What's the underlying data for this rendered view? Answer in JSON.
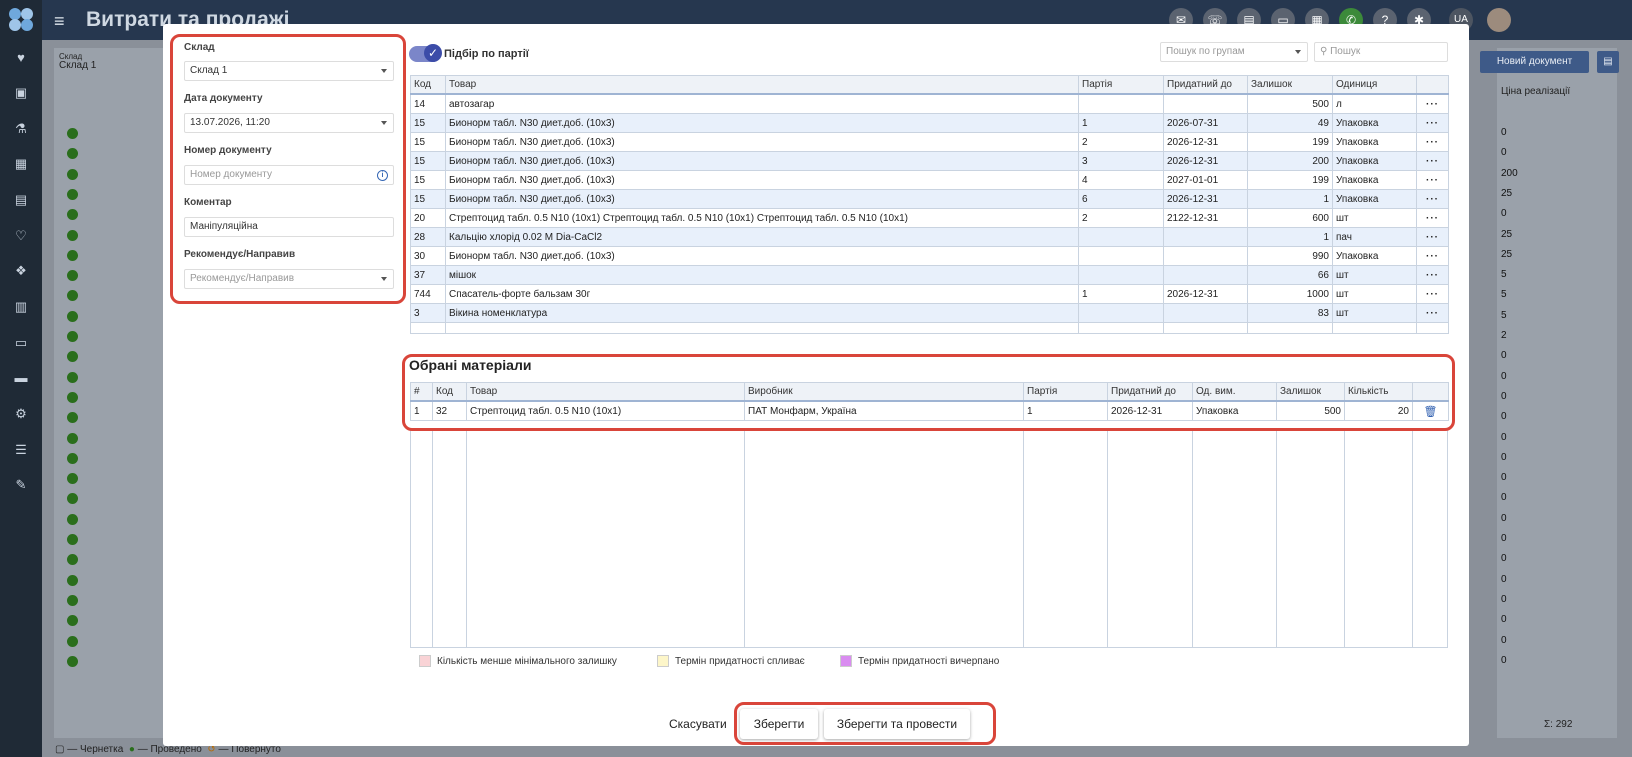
{
  "app": {
    "title": "Витрати та продажі",
    "lang": "UA",
    "notification_badge": "1",
    "new_document_label": "Новий документ",
    "bg_left_header": "Склад",
    "bg_left_value": "Склад 1",
    "bg_right_header": "Ціна реалізації",
    "bg_right_values": [
      "0",
      "0",
      "200",
      "25",
      "0",
      "25",
      "25",
      "5",
      "5",
      "5",
      "2",
      "0",
      "0",
      "0",
      "0",
      "0",
      "0",
      "0",
      "0",
      "0",
      "0",
      "0",
      "0",
      "0",
      "0",
      "0",
      "0"
    ],
    "bg_sum": "Σ: 292",
    "footer_legend": [
      "— Чернетка",
      "— Проведено",
      "— Повернуто"
    ]
  },
  "form": {
    "warehouse_label": "Склад",
    "warehouse_value": "Склад 1",
    "date_label": "Дата документу",
    "date_value": "13.07.2026, 11:20",
    "number_label": "Номер документу",
    "number_placeholder": "Номер документу",
    "comment_label": "Коментар",
    "comment_value": "Маніпуляційна",
    "recommender_label": "Рекомендує/Направив",
    "recommender_placeholder": "Рекомендує/Направив"
  },
  "toolbar": {
    "batch_toggle_label": "Підбір по партії",
    "batch_toggle_on": true,
    "group_search_placeholder": "Пошук по групам",
    "search_placeholder": "Пошук"
  },
  "products": {
    "columns": [
      "Код",
      "Товар",
      "Партія",
      "Придатний до",
      "Залишок",
      "Одиниця"
    ],
    "rows": [
      {
        "code": "14",
        "name": "автозагар",
        "batch": "",
        "expiry": "",
        "stock": "500",
        "unit": "л"
      },
      {
        "code": "15",
        "name": "Бионорм табл. N30 диет.доб. (10х3)",
        "batch": "1",
        "expiry": "2026-07-31",
        "stock": "49",
        "unit": "Упаковка"
      },
      {
        "code": "15",
        "name": "Бионорм табл. N30 диет.доб. (10х3)",
        "batch": "2",
        "expiry": "2026-12-31",
        "stock": "199",
        "unit": "Упаковка"
      },
      {
        "code": "15",
        "name": "Бионорм табл. N30 диет.доб. (10х3)",
        "batch": "3",
        "expiry": "2026-12-31",
        "stock": "200",
        "unit": "Упаковка"
      },
      {
        "code": "15",
        "name": "Бионорм табл. N30 диет.доб. (10х3)",
        "batch": "4",
        "expiry": "2027-01-01",
        "stock": "199",
        "unit": "Упаковка"
      },
      {
        "code": "15",
        "name": "Бионорм табл. N30 диет.доб. (10х3)",
        "batch": "6",
        "expiry": "2026-12-31",
        "stock": "1",
        "unit": "Упаковка"
      },
      {
        "code": "20",
        "name": "Стрептоцид табл. 0.5 N10 (10х1) Стрептоцид табл. 0.5 N10 (10х1) Стрептоцид табл. 0.5 N10 (10х1)",
        "batch": "2",
        "expiry": "2122-12-31",
        "stock": "600",
        "unit": "шт"
      },
      {
        "code": "28",
        "name": "Кальцію хлорід 0.02 М Dia-CaCl2",
        "batch": "",
        "expiry": "",
        "stock": "1",
        "unit": "пач"
      },
      {
        "code": "30",
        "name": "Бионорм табл. N30 диет.доб. (10х3)",
        "batch": "",
        "expiry": "",
        "stock": "990",
        "unit": "Упаковка"
      },
      {
        "code": "37",
        "name": "мішок",
        "batch": "",
        "expiry": "",
        "stock": "66",
        "unit": "шт"
      },
      {
        "code": "744",
        "name": "Спасатель-форте бальзам 30г",
        "batch": "1",
        "expiry": "2026-12-31",
        "stock": "1000",
        "unit": "шт"
      },
      {
        "code": "3",
        "name": "Вікина номенклатура",
        "batch": "",
        "expiry": "",
        "stock": "83",
        "unit": "шт"
      }
    ]
  },
  "selected": {
    "title": "Обрані матеріали",
    "columns": [
      "#",
      "Код",
      "Товар",
      "Виробник",
      "Партія",
      "Придатний до",
      "Од. вим.",
      "Залишок",
      "Кількість"
    ],
    "rows": [
      {
        "idx": "1",
        "code": "32",
        "name": "Стрептоцид табл. 0.5 N10 (10х1)",
        "maker": "ПАТ Монфарм, Україна",
        "batch": "1",
        "expiry": "2026-12-31",
        "unit": "Упаковка",
        "stock": "500",
        "qty": "20"
      }
    ]
  },
  "legend": [
    {
      "label": "Кількість менше мінімального залишку",
      "color": "#f9d3d6"
    },
    {
      "label": "Термін придатності спливає",
      "color": "#fdf6c9"
    },
    {
      "label": "Термін придатності вичерпано",
      "color": "#d98cf0"
    }
  ],
  "actions": {
    "cancel": "Скасувати",
    "save": "Зберегти",
    "save_post": "Зберегти та провести"
  }
}
